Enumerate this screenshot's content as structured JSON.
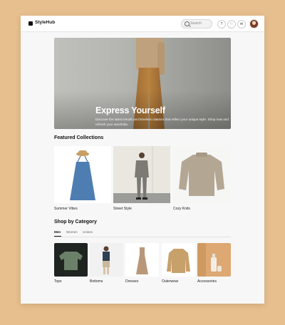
{
  "app": {
    "brand": "StyleHub"
  },
  "header": {
    "search_placeholder": "Search"
  },
  "hero": {
    "title": "Express Yourself",
    "subtitle": "Discover the latest trends and timeless classics that reflect your unique style. Shop now and refresh your wardrobe."
  },
  "featured": {
    "title": "Featured Collections",
    "items": [
      {
        "label": "Summer Vibes"
      },
      {
        "label": "Street Style"
      },
      {
        "label": "Cozy Knits"
      }
    ]
  },
  "categories": {
    "title": "Shop by Category",
    "tabs": [
      {
        "label": "Men"
      },
      {
        "label": "Women"
      },
      {
        "label": "Unisex"
      }
    ],
    "items": [
      {
        "label": "Tops"
      },
      {
        "label": "Bottoms"
      },
      {
        "label": "Dresses"
      },
      {
        "label": "Outerwear"
      },
      {
        "label": "Accessories"
      }
    ]
  },
  "colors": {
    "background": "#E7BE8E",
    "page": "#F7F7F7",
    "accent": "#111111"
  },
  "icons": [
    "search-icon",
    "help-icon",
    "heart-icon",
    "mail-icon"
  ]
}
